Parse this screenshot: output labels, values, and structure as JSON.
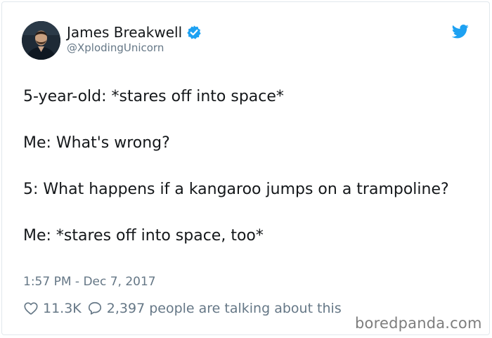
{
  "tweet": {
    "author_name": "James Breakwell",
    "author_handle": "@XplodingUnicorn",
    "paragraphs": [
      "5-year-old: *stares off into space*",
      "Me: What's wrong?",
      "5: What happens if a kangaroo jumps on a trampoline?",
      "Me: *stares off into space, too*"
    ],
    "timestamp": "1:57 PM - Dec 7, 2017",
    "likes": "11.3K",
    "talking": "2,397 people are talking about this"
  },
  "icons": {
    "verified": "verified-badge-icon",
    "bird": "twitter-bird-icon",
    "like": "heart-outline-icon",
    "reply": "speech-bubble-icon"
  },
  "colors": {
    "twitter_blue": "#1da1f2",
    "text": "#14171a",
    "secondary": "#657786",
    "border": "#e1e8ed"
  },
  "watermark": "boredpanda.com"
}
